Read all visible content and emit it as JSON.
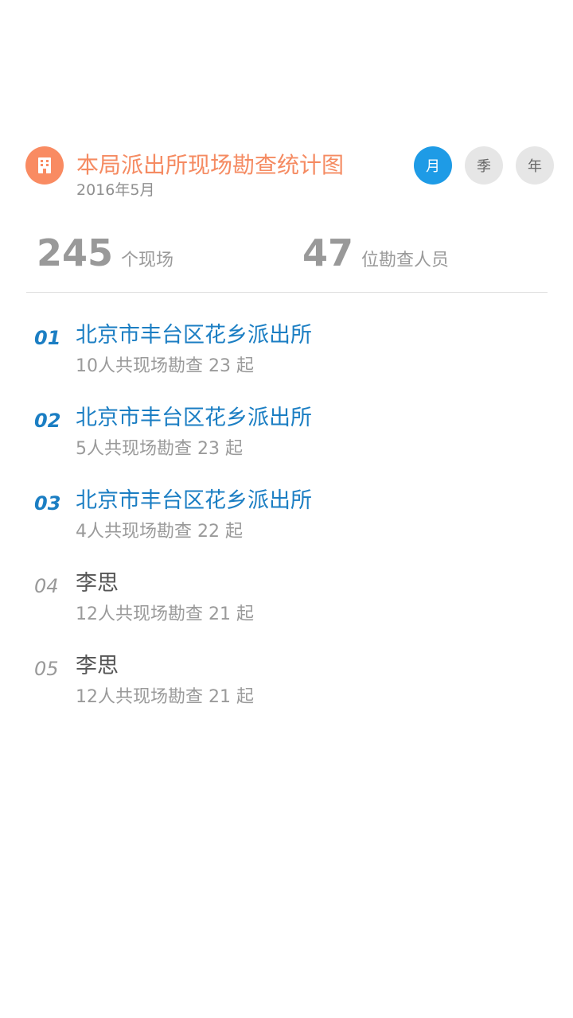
{
  "header": {
    "icon": "building-icon",
    "title": "本局派出所现场勘查统计图",
    "subtitle": "2016年5月"
  },
  "period_tabs": [
    {
      "label": "月",
      "active": true
    },
    {
      "label": "季",
      "active": false
    },
    {
      "label": "年",
      "active": false
    }
  ],
  "stats": {
    "scenes": {
      "value": "245",
      "label": "个现场"
    },
    "personnel": {
      "value": "47",
      "label": "位勘查人员"
    }
  },
  "ranking": [
    {
      "rank": "01",
      "name": "北京市丰台区花乡派出所",
      "detail": "10人共现场勘查 23 起"
    },
    {
      "rank": "02",
      "name": "北京市丰台区花乡派出所",
      "detail": "5人共现场勘查 23 起"
    },
    {
      "rank": "03",
      "name": "北京市丰台区花乡派出所",
      "detail": "4人共现场勘查 22 起"
    },
    {
      "rank": "04",
      "name": "李思",
      "detail": "12人共现场勘查 21 起"
    },
    {
      "rank": "05",
      "name": "李思",
      "detail": "12人共现场勘查 21 起"
    }
  ],
  "colors": {
    "accent_orange": "#f98b62",
    "accent_blue": "#1e9be6",
    "top_rank_blue": "#1b7ec3"
  }
}
